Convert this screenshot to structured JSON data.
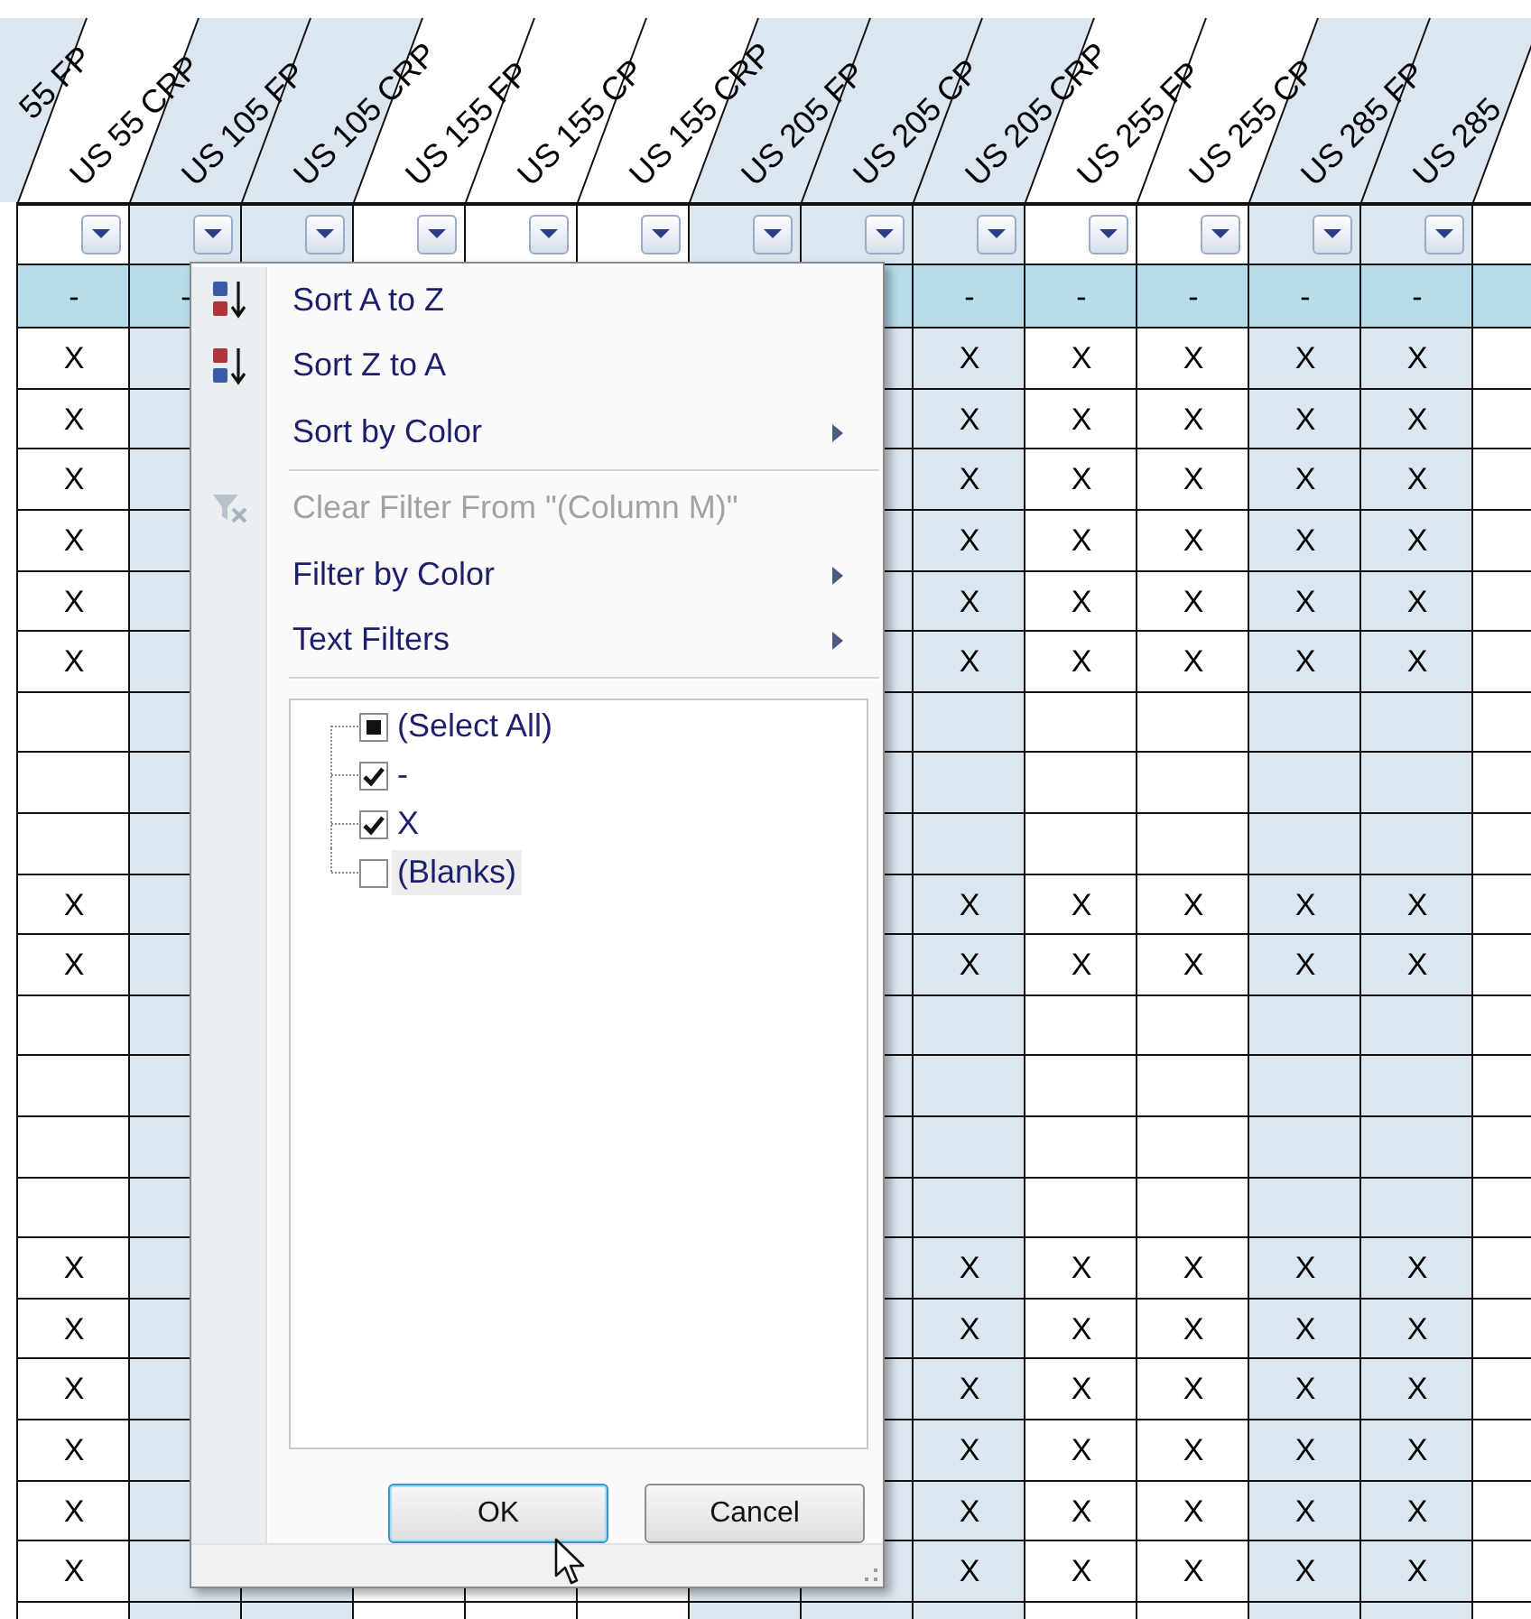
{
  "sheet": {
    "offscreen_header": {
      "label": "55 FP",
      "shaded": true
    },
    "columns": [
      {
        "header": "US 55 CRP",
        "shaded": false,
        "has_filter": true
      },
      {
        "header": "US 105 FP",
        "shaded": true,
        "has_filter": true
      },
      {
        "header": "US 105 CRP",
        "shaded": true,
        "has_filter": true
      },
      {
        "header": "US 155 FP",
        "shaded": false,
        "has_filter": true
      },
      {
        "header": "US 155 CP",
        "shaded": false,
        "has_filter": true
      },
      {
        "header": "US 155 CRP",
        "shaded": false,
        "has_filter": true
      },
      {
        "header": "US 205 FP",
        "shaded": true,
        "has_filter": true
      },
      {
        "header": "US 205 CP",
        "shaded": true,
        "has_filter": true
      },
      {
        "header": "US 205 CRP",
        "shaded": true,
        "has_filter": true
      },
      {
        "header": "US 255 FP",
        "shaded": false,
        "has_filter": true
      },
      {
        "header": "US 255 CP",
        "shaded": false,
        "has_filter": true
      },
      {
        "header": "US 285 FP",
        "shaded": true,
        "has_filter": true
      },
      {
        "header": "US 285",
        "shaded": true,
        "has_filter": true
      },
      {
        "shaded": false,
        "has_filter": false
      }
    ],
    "rows": [
      {
        "kind": "summary",
        "cells": [
          "-",
          "-",
          null,
          null,
          null,
          null,
          null,
          null,
          "-",
          "-",
          "-",
          "-",
          "-",
          null
        ]
      },
      {
        "kind": "data",
        "cells": [
          "X",
          null,
          null,
          null,
          null,
          null,
          null,
          null,
          "X",
          "X",
          "X",
          "X",
          "X",
          null
        ]
      },
      {
        "kind": "data",
        "cells": [
          "X",
          null,
          null,
          null,
          null,
          null,
          null,
          null,
          "X",
          "X",
          "X",
          "X",
          "X",
          null
        ]
      },
      {
        "kind": "data",
        "cells": [
          "X",
          null,
          null,
          null,
          null,
          null,
          null,
          null,
          "X",
          "X",
          "X",
          "X",
          "X",
          null
        ]
      },
      {
        "kind": "data",
        "cells": [
          "X",
          null,
          null,
          null,
          null,
          null,
          null,
          null,
          "X",
          "X",
          "X",
          "X",
          "X",
          null
        ]
      },
      {
        "kind": "data",
        "cells": [
          "X",
          null,
          null,
          null,
          null,
          null,
          null,
          null,
          "X",
          "X",
          "X",
          "X",
          "X",
          null
        ]
      },
      {
        "kind": "data",
        "cells": [
          "X",
          null,
          null,
          null,
          null,
          null,
          null,
          null,
          "X",
          "X",
          "X",
          "X",
          "X",
          null
        ]
      },
      {
        "kind": "blank"
      },
      {
        "kind": "blank"
      },
      {
        "kind": "blank"
      },
      {
        "kind": "data",
        "cells": [
          "X",
          null,
          null,
          null,
          null,
          null,
          null,
          null,
          "X",
          "X",
          "X",
          "X",
          "X",
          null
        ]
      },
      {
        "kind": "data",
        "cells": [
          "X",
          null,
          null,
          null,
          null,
          null,
          null,
          null,
          "X",
          "X",
          "X",
          "X",
          "X",
          null
        ]
      },
      {
        "kind": "blank"
      },
      {
        "kind": "blank"
      },
      {
        "kind": "blank"
      },
      {
        "kind": "blank"
      },
      {
        "kind": "data",
        "cells": [
          "X",
          null,
          null,
          null,
          null,
          null,
          null,
          null,
          "X",
          "X",
          "X",
          "X",
          "X",
          null
        ]
      },
      {
        "kind": "data",
        "cells": [
          "X",
          null,
          null,
          null,
          null,
          null,
          null,
          null,
          "X",
          "X",
          "X",
          "X",
          "X",
          null
        ]
      },
      {
        "kind": "data",
        "cells": [
          "X",
          null,
          null,
          null,
          null,
          null,
          null,
          null,
          "X",
          "X",
          "X",
          "X",
          "X",
          null
        ]
      },
      {
        "kind": "data",
        "cells": [
          "X",
          null,
          null,
          null,
          null,
          null,
          null,
          null,
          "X",
          "X",
          "X",
          "X",
          "X",
          null
        ]
      },
      {
        "kind": "data",
        "cells": [
          "X",
          null,
          null,
          null,
          null,
          null,
          null,
          null,
          "X",
          "X",
          "X",
          "X",
          "X",
          null
        ]
      },
      {
        "kind": "data",
        "cells": [
          "X",
          null,
          null,
          null,
          null,
          null,
          null,
          null,
          "X",
          "X",
          "X",
          "X",
          "X",
          null
        ]
      }
    ]
  },
  "filter_menu": {
    "items": [
      {
        "kind": "sort-ascending",
        "label": "Sort A to Z",
        "disabled": false,
        "submenu": false
      },
      {
        "kind": "sort-descending",
        "label": "Sort Z to A",
        "disabled": false,
        "submenu": false
      },
      {
        "kind": "command",
        "label": "Sort by Color",
        "disabled": false,
        "submenu": true
      },
      {
        "kind": "separator"
      },
      {
        "kind": "clear-filter",
        "label": "Clear Filter From \"(Column M)\"",
        "disabled": true,
        "submenu": false
      },
      {
        "kind": "command",
        "label": "Filter by Color",
        "disabled": false,
        "submenu": true
      },
      {
        "kind": "command",
        "label": "Text Filters",
        "disabled": false,
        "submenu": true
      },
      {
        "kind": "separator"
      }
    ],
    "values": [
      {
        "label": "(Select All)",
        "checked": false,
        "indeterminate": true,
        "selected": false
      },
      {
        "label": "-",
        "checked": true,
        "indeterminate": false,
        "selected": false
      },
      {
        "label": "X",
        "checked": true,
        "indeterminate": false,
        "selected": false
      },
      {
        "label": "(Blanks)",
        "checked": false,
        "indeterminate": false,
        "selected": true
      }
    ],
    "buttons": [
      {
        "label": "OK",
        "default": true
      },
      {
        "label": "Cancel",
        "default": false
      }
    ]
  }
}
